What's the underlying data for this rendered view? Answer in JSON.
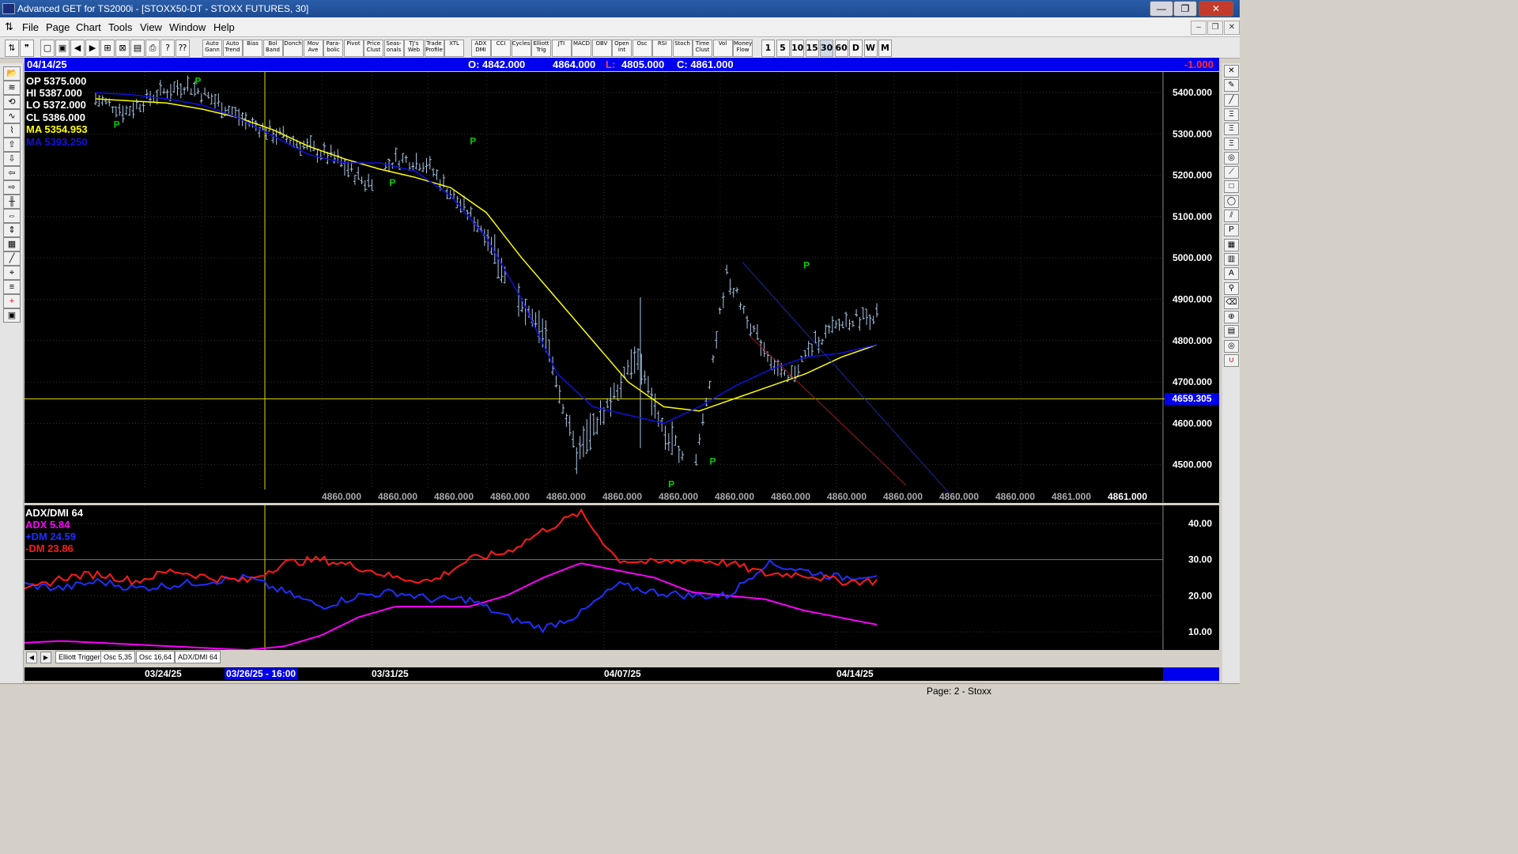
{
  "window": {
    "title": "Advanced GET for TS2000i - [STOXX50-DT - STOXX FUTURES, 30]",
    "close_glyph": "✕",
    "min_glyph": "—",
    "max_glyph": "❐"
  },
  "menu": {
    "items": [
      "File",
      "Page",
      "Chart",
      "Tools",
      "View",
      "Window",
      "Help"
    ]
  },
  "toolbar": {
    "studies": [
      "Auto Gann",
      "Auto Trend",
      "Bias",
      "Bol Band",
      "Donch",
      "Mov Ave",
      "Para-bolic",
      "Pivot",
      "Price Clust",
      "Seas-onals",
      "TJ's Web",
      "Trade Profile",
      "XTL",
      "ADX DMI",
      "CCI",
      "Cycles",
      "Elliott Trig",
      "JTI",
      "MACD",
      "OBV",
      "Open Int",
      "Osc",
      "RSI",
      "Stoch",
      "Time Clust",
      "Vol",
      "Money Flow"
    ],
    "timeframes": [
      "1",
      "5",
      "10",
      "15",
      "30",
      "60",
      "D",
      "W",
      "M"
    ],
    "active_timeframe": "30"
  },
  "info": {
    "date": "04/14/25",
    "open": "O: 4842.000",
    "high": "4864.000",
    "low_label": "L:",
    "low": "4805.000",
    "close": "C: 4861.000",
    "change": "-1.000"
  },
  "price_readout": {
    "op": "OP 5375.000",
    "hi": "HI  5387.000",
    "lo": "LO  5372.000",
    "cl": "CL  5386.000",
    "ma1": "MA 5354.953",
    "ma2": "MA 5393.250"
  },
  "cursor_price": "4659.305",
  "bottom_values": [
    "4860.000",
    "4860.000",
    "4860.000",
    "4860.000",
    "4860.000",
    "4860.000",
    "4860.000",
    "4860.000",
    "4860.000",
    "4860.000",
    "4860.000",
    "4860.000",
    "4860.000",
    "4861.000",
    "4861.000"
  ],
  "pivots": [
    "P",
    "P",
    "P",
    "P",
    "P",
    "P",
    "P"
  ],
  "osc": {
    "title": "ADX/DMI 64",
    "adx": "ADX 5.84",
    "pdm": "+DM 24.59",
    "mdm": "-DM  23.86"
  },
  "tabs": [
    "Elliott Trigger",
    "Osc 5,35",
    "Osc 16,64",
    "ADX/DMI 64"
  ],
  "date_axis": {
    "labels": [
      "03/24/25",
      "03/31/25",
      "04/07/25",
      "04/14/25"
    ],
    "cursor_label": "03/26/25 - 16:00"
  },
  "status": {
    "page": "Page: 2 - Stoxx"
  },
  "colors": {
    "ma_yellow": "#ffff00",
    "ma_blue": "#1010e0",
    "adx": "#ff00ff",
    "pdm": "#1f2fff",
    "mdm": "#ff1a1a",
    "pivot": "#00cc00",
    "bars": "#a9c8e8"
  },
  "chart_data": [
    {
      "type": "line",
      "title": "",
      "ylabel": "",
      "ylim": [
        4440,
        5450
      ],
      "yticks": [
        "5400.000",
        "5300.000",
        "5200.000",
        "5100.000",
        "5000.000",
        "4900.000",
        "4800.000",
        "4700.000",
        "4600.000",
        "4500.000"
      ],
      "x": [
        "03/24/25",
        "03/31/25",
        "04/07/25",
        "04/14/25"
      ],
      "series": [
        {
          "name": "Price",
          "values": [
            5385,
            5355,
            5395,
            5420,
            5380,
            5330,
            5300,
            5270,
            5240,
            5180,
            5240,
            5230,
            5140,
            5060,
            4900,
            4800,
            4520,
            4640,
            4760,
            4560,
            4510,
            4960,
            4810,
            4700,
            4800,
            4850,
            4862
          ]
        },
        {
          "name": "MA 5354.953",
          "values": [
            5385,
            5380,
            5375,
            5360,
            5340,
            5310,
            5270,
            5240,
            5215,
            5195,
            5170,
            5110,
            5000,
            4900,
            4800,
            4700,
            4640,
            4630,
            4660,
            4690,
            4720,
            4760,
            4790
          ]
        },
        {
          "name": "MA 5393.250",
          "values": [
            5400,
            5395,
            5385,
            5370,
            5340,
            5295,
            5250,
            5230,
            5230,
            5210,
            5150,
            5050,
            4900,
            4720,
            4640,
            4620,
            4600,
            4640,
            4690,
            4730,
            4760,
            4770,
            4790
          ]
        }
      ]
    },
    {
      "type": "line",
      "title": "ADX/DMI 64",
      "ylim": [
        5,
        45
      ],
      "yticks": [
        "40.00",
        "30.00",
        "20.00",
        "10.00"
      ],
      "series": [
        {
          "name": "ADX 5.84",
          "values": [
            7,
            7.5,
            7,
            6.5,
            6,
            5.5,
            5,
            6,
            9,
            14,
            17,
            17,
            17,
            20,
            25,
            29,
            27,
            25,
            21,
            20,
            19,
            16,
            14,
            12
          ]
        },
        {
          "name": "+DM 24.59",
          "values": [
            23,
            22,
            24,
            22,
            23,
            24,
            25,
            21,
            17,
            20,
            21,
            19,
            19,
            14,
            11,
            15,
            23,
            21,
            20,
            20,
            29,
            27,
            25,
            26
          ]
        },
        {
          "name": "-DM  23.86",
          "values": [
            21,
            25,
            26,
            24,
            27,
            25,
            24,
            29,
            30,
            28,
            25,
            24,
            30,
            32,
            38,
            43,
            30,
            29,
            30,
            29,
            26,
            26,
            24,
            24
          ]
        }
      ]
    }
  ]
}
